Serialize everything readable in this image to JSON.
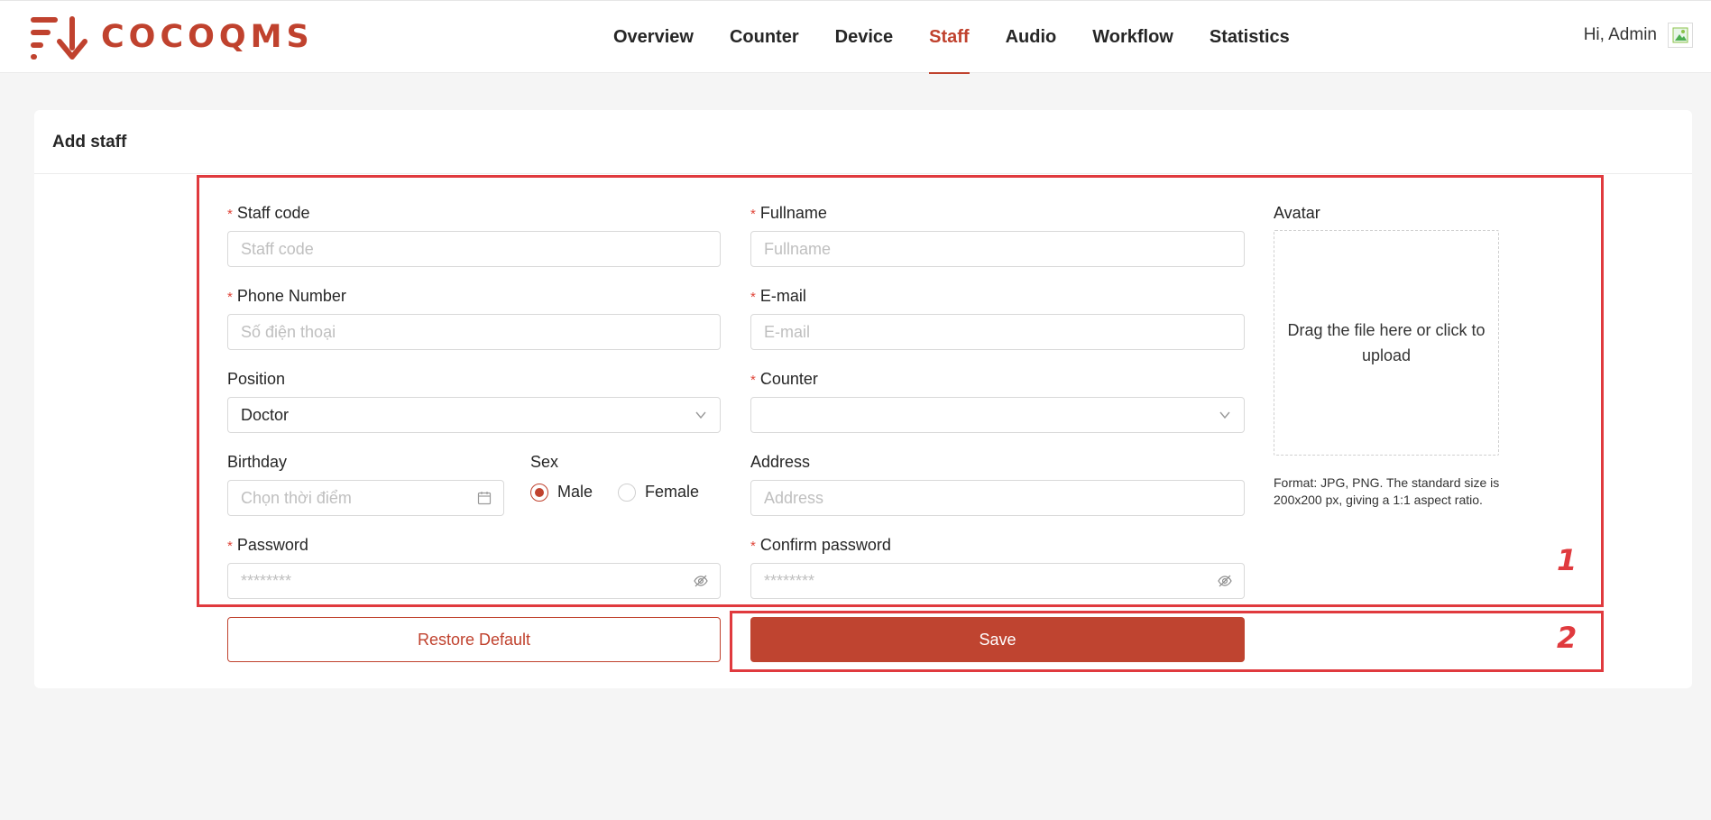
{
  "brand": {
    "name": "COCOQMS",
    "color": "#c0422e"
  },
  "nav": {
    "items": [
      {
        "label": "Overview"
      },
      {
        "label": "Counter"
      },
      {
        "label": "Device"
      },
      {
        "label": "Staff",
        "active": true
      },
      {
        "label": "Audio"
      },
      {
        "label": "Workflow"
      },
      {
        "label": "Statistics"
      }
    ]
  },
  "user": {
    "greeting": "Hi, Admin"
  },
  "page": {
    "title": "Add staff"
  },
  "form": {
    "staff_code": {
      "label": "Staff code",
      "placeholder": "Staff code",
      "value": ""
    },
    "fullname": {
      "label": "Fullname",
      "placeholder": "Fullname",
      "value": ""
    },
    "phone": {
      "label": "Phone Number",
      "placeholder": "Số điện thoại",
      "value": ""
    },
    "email": {
      "label": "E-mail",
      "placeholder": "E-mail",
      "value": ""
    },
    "position": {
      "label": "Position",
      "value": "Doctor"
    },
    "counter": {
      "label": "Counter",
      "value": ""
    },
    "birthday": {
      "label": "Birthday",
      "placeholder": "Chọn thời điểm",
      "value": ""
    },
    "sex": {
      "label": "Sex",
      "options": [
        "Male",
        "Female"
      ],
      "selected": "Male"
    },
    "address": {
      "label": "Address",
      "placeholder": "Address",
      "value": ""
    },
    "password": {
      "label": "Password",
      "placeholder": "********",
      "value": ""
    },
    "confirm_password": {
      "label": "Confirm password",
      "placeholder": "********",
      "value": ""
    },
    "required_mark": "*"
  },
  "avatar": {
    "label": "Avatar",
    "upload_text": "Drag the file here or click to upload",
    "note": "Format: JPG, PNG. The standard size is 200x200 px, giving a 1:1 aspect ratio."
  },
  "actions": {
    "restore_label": "Restore Default",
    "save_label": "Save"
  },
  "annotations": {
    "box1_number": "1",
    "box2_number": "2"
  }
}
